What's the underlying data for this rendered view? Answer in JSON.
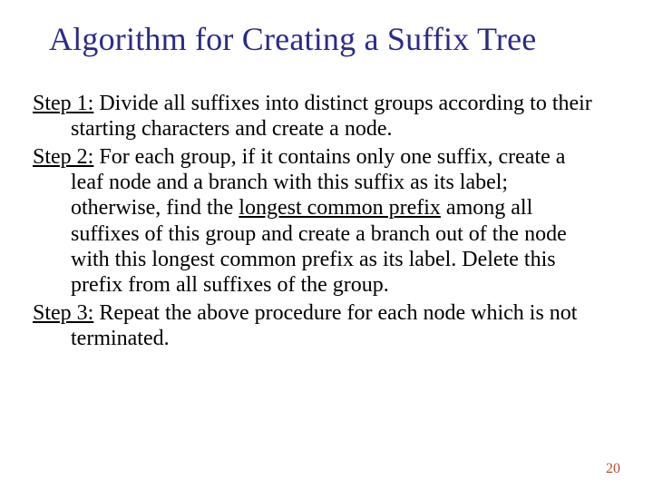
{
  "title": "Algorithm for Creating a Suffix Tree",
  "steps": {
    "s1": {
      "label": "Step 1:",
      "text_a": " Divide all suffixes into distinct groups according to their starting characters and create a node."
    },
    "s2": {
      "label": "Step 2:",
      "text_a": " For each group, if it contains only one suffix, create a leaf node and a branch with this suffix as its label; otherwise, find the ",
      "lcp": "longest common prefix",
      "text_b": " among all suffixes of this group and create a branch out of the node with this longest common prefix as its label. Delete this prefix from all suffixes of the group."
    },
    "s3": {
      "label": "Step 3:",
      "text_a": " Repeat the above procedure for each node which is not terminated."
    }
  },
  "page_number": "20"
}
